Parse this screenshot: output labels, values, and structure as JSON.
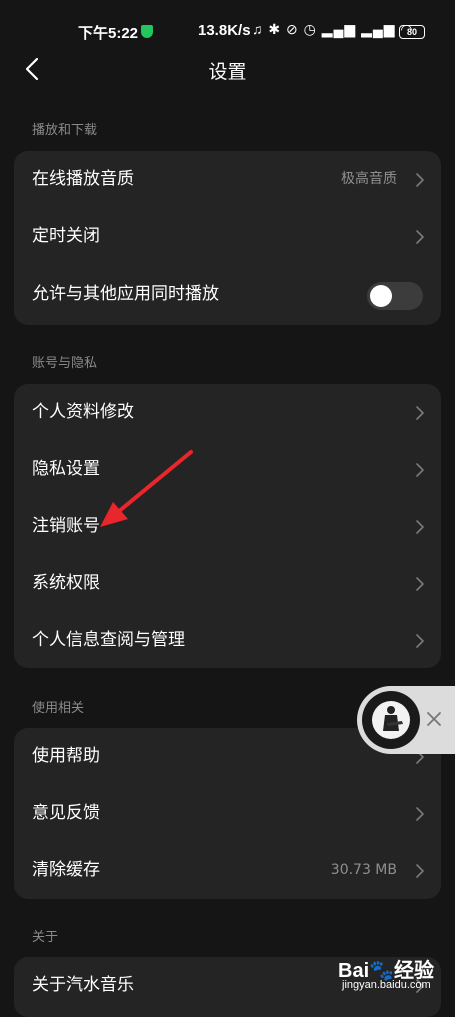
{
  "status_bar": {
    "time": "下午5:22",
    "net_speed": "13.8K/s",
    "icons_text": "♫ ✱ ⊘ ◷ ▂▄▆ ▂▄▆ ◠",
    "battery": "80",
    "icons": [
      "shield-icon",
      "headphone-icon",
      "bluetooth-icon",
      "mute-bell-icon",
      "alarm-icon",
      "signal-icon",
      "signal-icon",
      "wifi-icon",
      "battery-icon"
    ]
  },
  "header": {
    "title": "设置"
  },
  "sections": {
    "playback": {
      "label": "播放和下载",
      "items": [
        {
          "label": "在线播放音质",
          "value": "极高音质"
        },
        {
          "label": "定时关闭"
        },
        {
          "label": "允许与其他应用同时播放",
          "toggle": false
        }
      ]
    },
    "account": {
      "label": "账号与隐私",
      "items": [
        {
          "label": "个人资料修改"
        },
        {
          "label": "隐私设置"
        },
        {
          "label": "注销账号"
        },
        {
          "label": "系统权限"
        },
        {
          "label": "个人信息查阅与管理"
        }
      ]
    },
    "usage": {
      "label": "使用相关",
      "items": [
        {
          "label": "使用帮助"
        },
        {
          "label": "意见反馈"
        },
        {
          "label": "清除缓存",
          "value": "30.73 MB"
        }
      ]
    },
    "about": {
      "label": "关于",
      "items": [
        {
          "label": "关于汽水音乐"
        }
      ]
    }
  },
  "watermark": {
    "logo": "Bai🐾经验",
    "url": "jingyan.baidu.com"
  },
  "colors": {
    "background": "#151515",
    "card": "#242424",
    "section_label": "#8a8a8a",
    "annotation_arrow": "#e8262b",
    "toggle_off": "#3c3c3c"
  }
}
